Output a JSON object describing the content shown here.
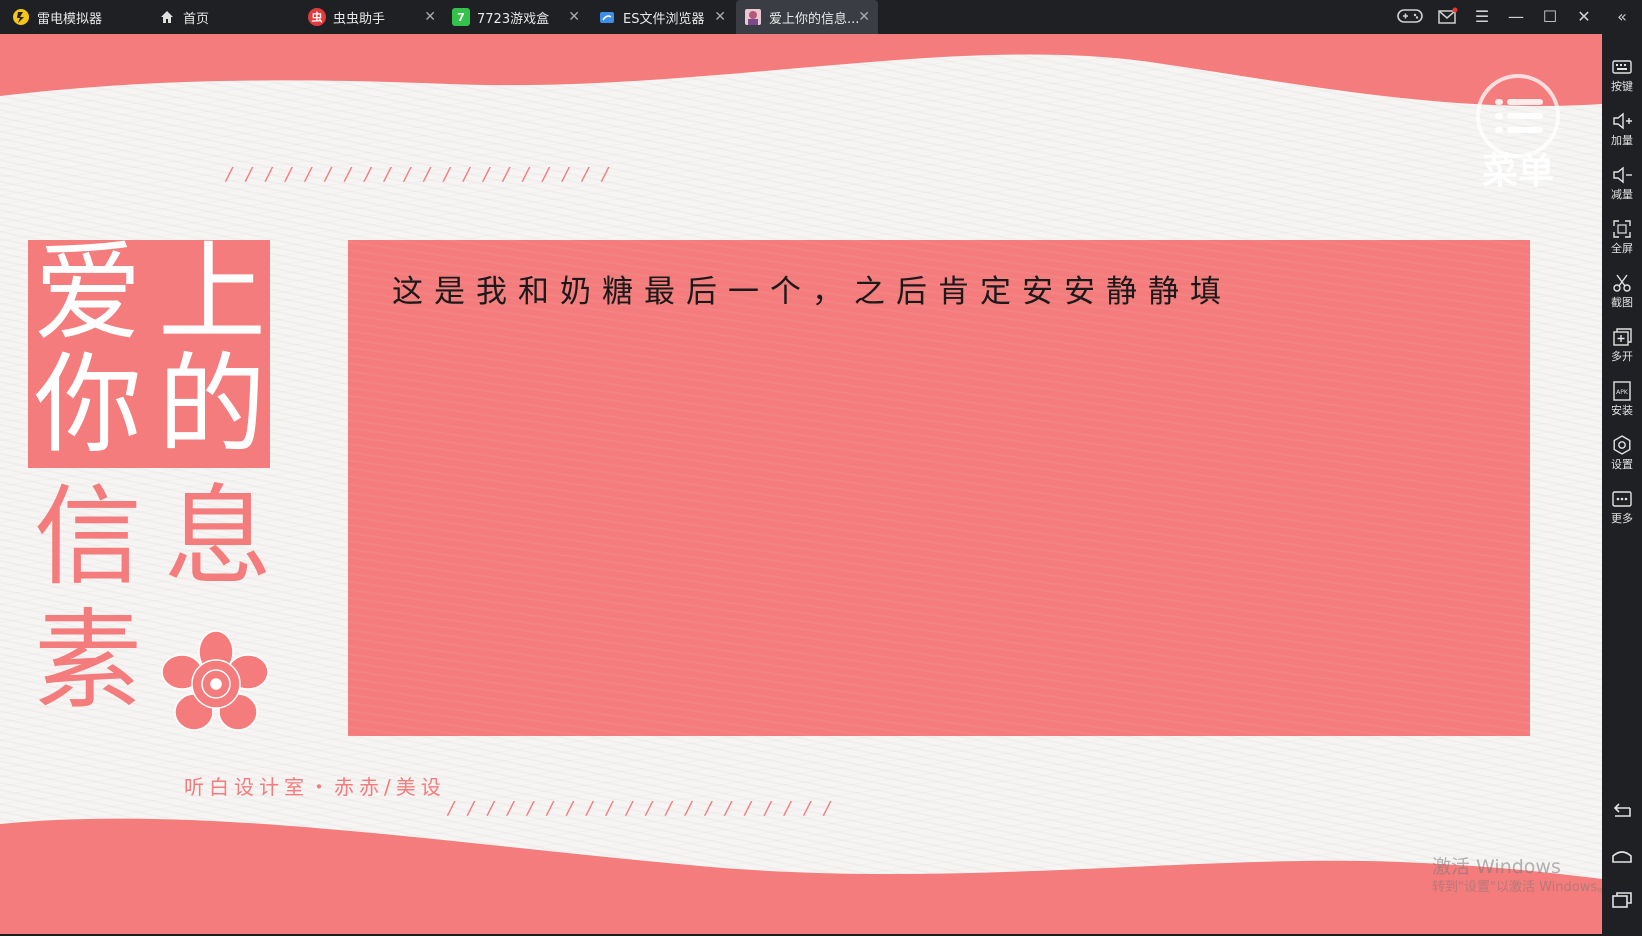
{
  "titlebar": {
    "tabs": [
      {
        "label": "雷电模拟器",
        "icon": "leidian-logo-icon",
        "closable": false,
        "active": false
      },
      {
        "label": "首页",
        "icon": "home-icon",
        "closable": false,
        "active": false
      },
      {
        "label": "虫虫助手",
        "icon": "chongchong-app-icon",
        "closable": true,
        "active": false
      },
      {
        "label": "7723游戏盒",
        "icon": "7723-app-icon",
        "closable": true,
        "active": false
      },
      {
        "label": "ES文件浏览器",
        "icon": "es-explorer-icon",
        "closable": true,
        "active": false
      },
      {
        "label": "爱上你的信息...",
        "icon": "game-avatar-icon",
        "closable": true,
        "active": true
      }
    ]
  },
  "screen": {
    "title_chars": {
      "c1": "爱",
      "c2": "上",
      "c3": "你",
      "c4": "的",
      "c5": "信",
      "c6": "息",
      "c7": "素"
    },
    "dashes": "/ / / / / / / / / / / / / / / / / / / /",
    "card_text": "这是我和奶糖最后一个，之后肯定安安静静填",
    "studio": "听白设计室・赤赤/美设",
    "menu_watermark": "菜单",
    "windows_watermark": "激活 Windows",
    "windows_watermark_sub": "转到\"设置\"以激活 Windows。"
  },
  "sidebar": {
    "items": [
      {
        "label": "按键",
        "icon": "keyboard-icon"
      },
      {
        "label": "加量",
        "icon": "volume-up-icon"
      },
      {
        "label": "减量",
        "icon": "volume-down-icon"
      },
      {
        "label": "全屏",
        "icon": "fullscreen-icon"
      },
      {
        "label": "截图",
        "icon": "scissors-icon"
      },
      {
        "label": "多开",
        "icon": "multi-instance-icon"
      },
      {
        "label": "安装",
        "icon": "apk-icon"
      },
      {
        "label": "设置",
        "icon": "gear-icon"
      },
      {
        "label": "更多",
        "icon": "more-icon"
      }
    ]
  },
  "colors": {
    "accent": "#f47c7c",
    "chrome": "#1e2024",
    "screen_bg": "#f6f5f3"
  }
}
